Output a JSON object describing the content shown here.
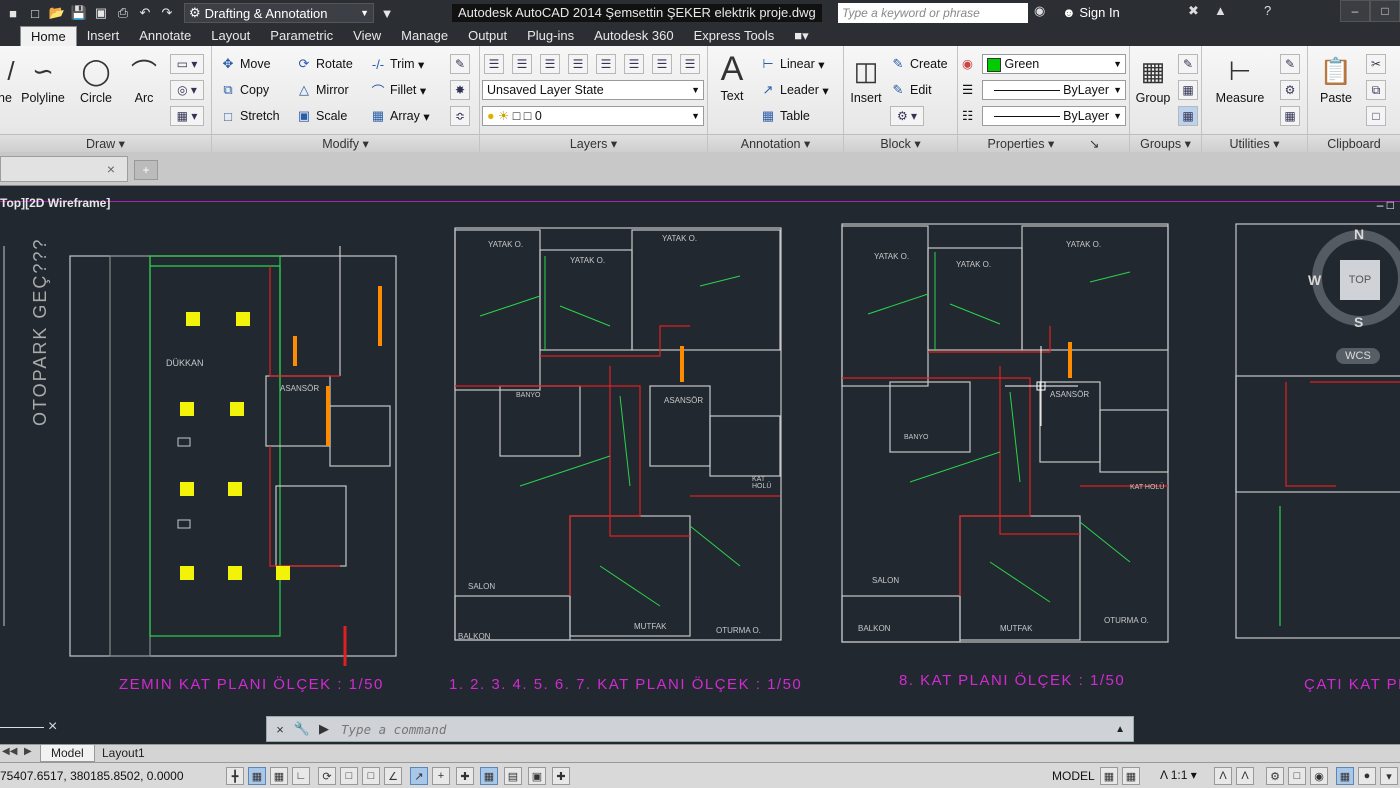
{
  "titlebar": {
    "workspace": "Drafting & Annotation",
    "app_title": "Autodesk AutoCAD 2014   Şemsettin ŞEKER elektrik proje.dwg",
    "search_placeholder": "Type a keyword or phrase",
    "sign_in": "Sign In"
  },
  "tabs": [
    "Home",
    "Insert",
    "Annotate",
    "Layout",
    "Parametric",
    "View",
    "Manage",
    "Output",
    "Plug-ins",
    "Autodesk 360",
    "Express Tools"
  ],
  "ribbon": {
    "draw": {
      "title": "Draw",
      "line": "ne",
      "polyline": "Polyline",
      "circle": "Circle",
      "arc": "Arc"
    },
    "modify": {
      "title": "Modify",
      "move": "Move",
      "rotate": "Rotate",
      "trim": "Trim",
      "copy": "Copy",
      "mirror": "Mirror",
      "fillet": "Fillet",
      "stretch": "Stretch",
      "scale": "Scale",
      "array": "Array"
    },
    "layers": {
      "title": "Layers",
      "layer_state": "Unsaved Layer State",
      "current_layer": "0"
    },
    "annotation": {
      "title": "Annotation",
      "text": "Text",
      "linear": "Linear",
      "leader": "Leader",
      "table": "Table"
    },
    "block": {
      "title": "Block",
      "insert": "Insert",
      "create": "Create",
      "edit": "Edit"
    },
    "properties": {
      "title": "Properties",
      "color": "Green",
      "color_hex": "#00cc00",
      "linetype": "ByLayer",
      "lineweight": "ByLayer"
    },
    "groups": {
      "title": "Groups",
      "group": "Group"
    },
    "utilities": {
      "title": "Utilities",
      "measure": "Measure"
    },
    "clipboard": {
      "title": "Clipboard",
      "paste": "Paste"
    }
  },
  "viewport": {
    "label": "Top][2D Wireframe]",
    "compass_n": "N",
    "compass_s": "S",
    "compass_w": "W",
    "cube_top": "TOP",
    "wcs": "WCS"
  },
  "plans": [
    {
      "title": "ZEMIN KAT PLANI ÖLÇEK : 1/50",
      "room": "DÜKKAN",
      "side_label": "OTOPARK GEÇ???",
      "lift": "ASANSÖR"
    },
    {
      "title": "1. 2. 3. 4. 5. 6. 7. KAT PLANI ÖLÇEK : 1/50",
      "rooms": [
        "YATAK O.",
        "YATAK O.",
        "YATAK O.",
        "BANYO",
        "ASANSÖR",
        "KAT HOLÜ",
        "SALON",
        "BALKON",
        "MUTFAK",
        "OTURMA O."
      ]
    },
    {
      "title": "8. KAT PLANI ÖLÇEK : 1/50",
      "rooms": [
        "YATAK O.",
        "YATAK O.",
        "YATAK O.",
        "BANYO",
        "ASANSÖR",
        "KAT HOLÜ",
        "SALON",
        "BALKON",
        "MUTFAK",
        "OTURMA O."
      ]
    },
    {
      "title": "ÇATI KAT PLAN"
    }
  ],
  "command": {
    "placeholder": "Type a command"
  },
  "layout_tabs": {
    "model": "Model",
    "layout1": "Layout1"
  },
  "status": {
    "coords": "75407.6517, 380185.8502, 0.0000",
    "model": "MODEL",
    "scale": "1:1"
  }
}
